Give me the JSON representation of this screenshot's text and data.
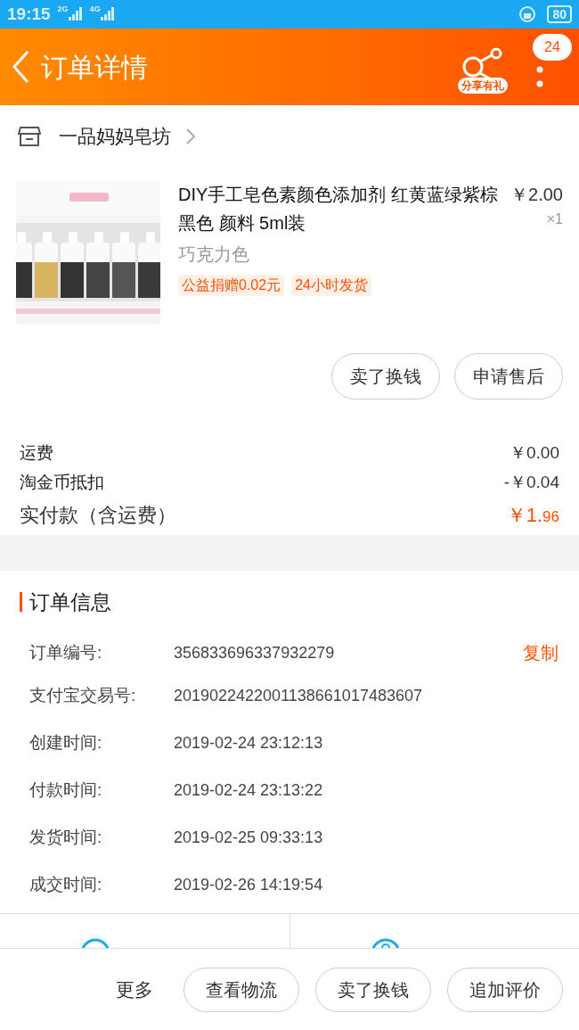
{
  "status_bar": {
    "time": "19:15",
    "signal_1": "2G",
    "signal_2": "4G",
    "battery": "80"
  },
  "header": {
    "title": "订单详情",
    "share_label": "分享有礼",
    "badge": "24"
  },
  "shop": {
    "name": "一品妈妈皂坊"
  },
  "product": {
    "kind": "picture",
    "title": "DIY手工皂色素颜色添加剂 红黄蓝绿紫棕黑色 颜料 5ml装",
    "price": "￥2.00",
    "quantity": "×1",
    "variant": "巧克力色",
    "tags": [
      "公益捐赠0.02元",
      "24小时发货"
    ],
    "buttons": [
      "卖了换钱",
      "申请售后"
    ]
  },
  "costs": [
    {
      "label": "运费",
      "value": "￥0.00",
      "kind": "plain"
    },
    {
      "label": "淘金币抵扣",
      "value": "-￥0.04",
      "kind": "plain"
    },
    {
      "label": "实付款（含运费）",
      "value": "￥1.",
      "value_small": "96",
      "kind": "total"
    }
  ],
  "order_info": {
    "title": "订单信息",
    "copy_label": "复制",
    "rows": [
      {
        "label": "订单编号:",
        "value": "356833696337932279"
      },
      {
        "label": "支付宝交易号:",
        "value": "2019022422001138661017483607"
      },
      {
        "label": "创建时间:",
        "value": "2019-02-24 23:12:13"
      },
      {
        "label": "付款时间:",
        "value": "2019-02-24 23:13:22"
      },
      {
        "label": "发货时间:",
        "value": "2019-02-25 09:33:13"
      },
      {
        "label": "成交时间:",
        "value": "2019-02-26 14:19:54"
      }
    ]
  },
  "bottom_bar": {
    "more": "更多",
    "buttons": [
      "查看物流",
      "卖了换钱",
      "追加评价"
    ]
  }
}
